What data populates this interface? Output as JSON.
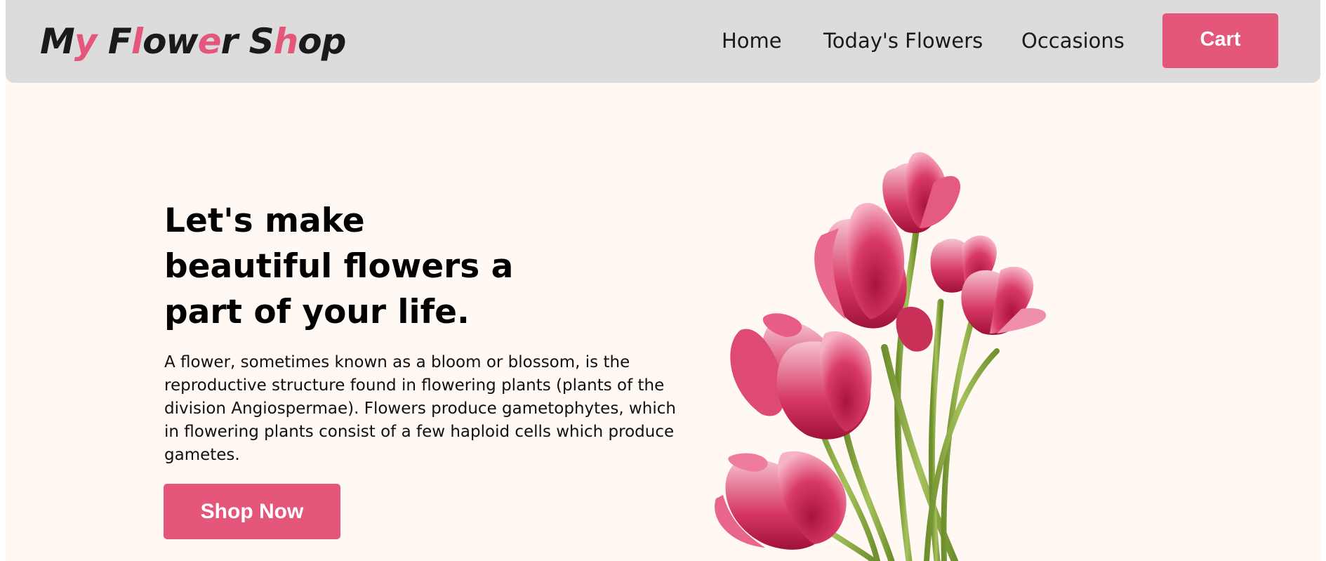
{
  "header": {
    "logo": {
      "parts": [
        {
          "text": "M",
          "accent": false
        },
        {
          "text": "y",
          "accent": true
        },
        {
          "text": " F",
          "accent": false
        },
        {
          "text": "l",
          "accent": true
        },
        {
          "text": "ow",
          "accent": false
        },
        {
          "text": "e",
          "accent": true
        },
        {
          "text": "r S",
          "accent": false
        },
        {
          "text": "h",
          "accent": true
        },
        {
          "text": "op",
          "accent": false
        }
      ]
    },
    "nav": {
      "home": "Home",
      "todays_flowers": "Today's Flowers",
      "occasions": "Occasions"
    },
    "cart_label": "Cart"
  },
  "hero": {
    "title_lines": [
      "Let's make",
      "beautiful flowers a",
      "part of your life."
    ],
    "description": "A flower, sometimes known as a bloom or blossom, is the reproductive structure found in flowering plants (plants of the division Angiospermae). Flowers produce gametophytes, which in flowering plants consist of a few haploid cells which produce gametes.",
    "cta_label": "Shop Now",
    "image": "tulip-bouquet-image"
  },
  "colors": {
    "accent": "#e5577a",
    "navbar_bg": "#dcdcdc",
    "page_bg": "#fff8f3",
    "tulip_dark": "#c8244f",
    "tulip_light": "#f28aa6",
    "stem": "#8aa845"
  }
}
